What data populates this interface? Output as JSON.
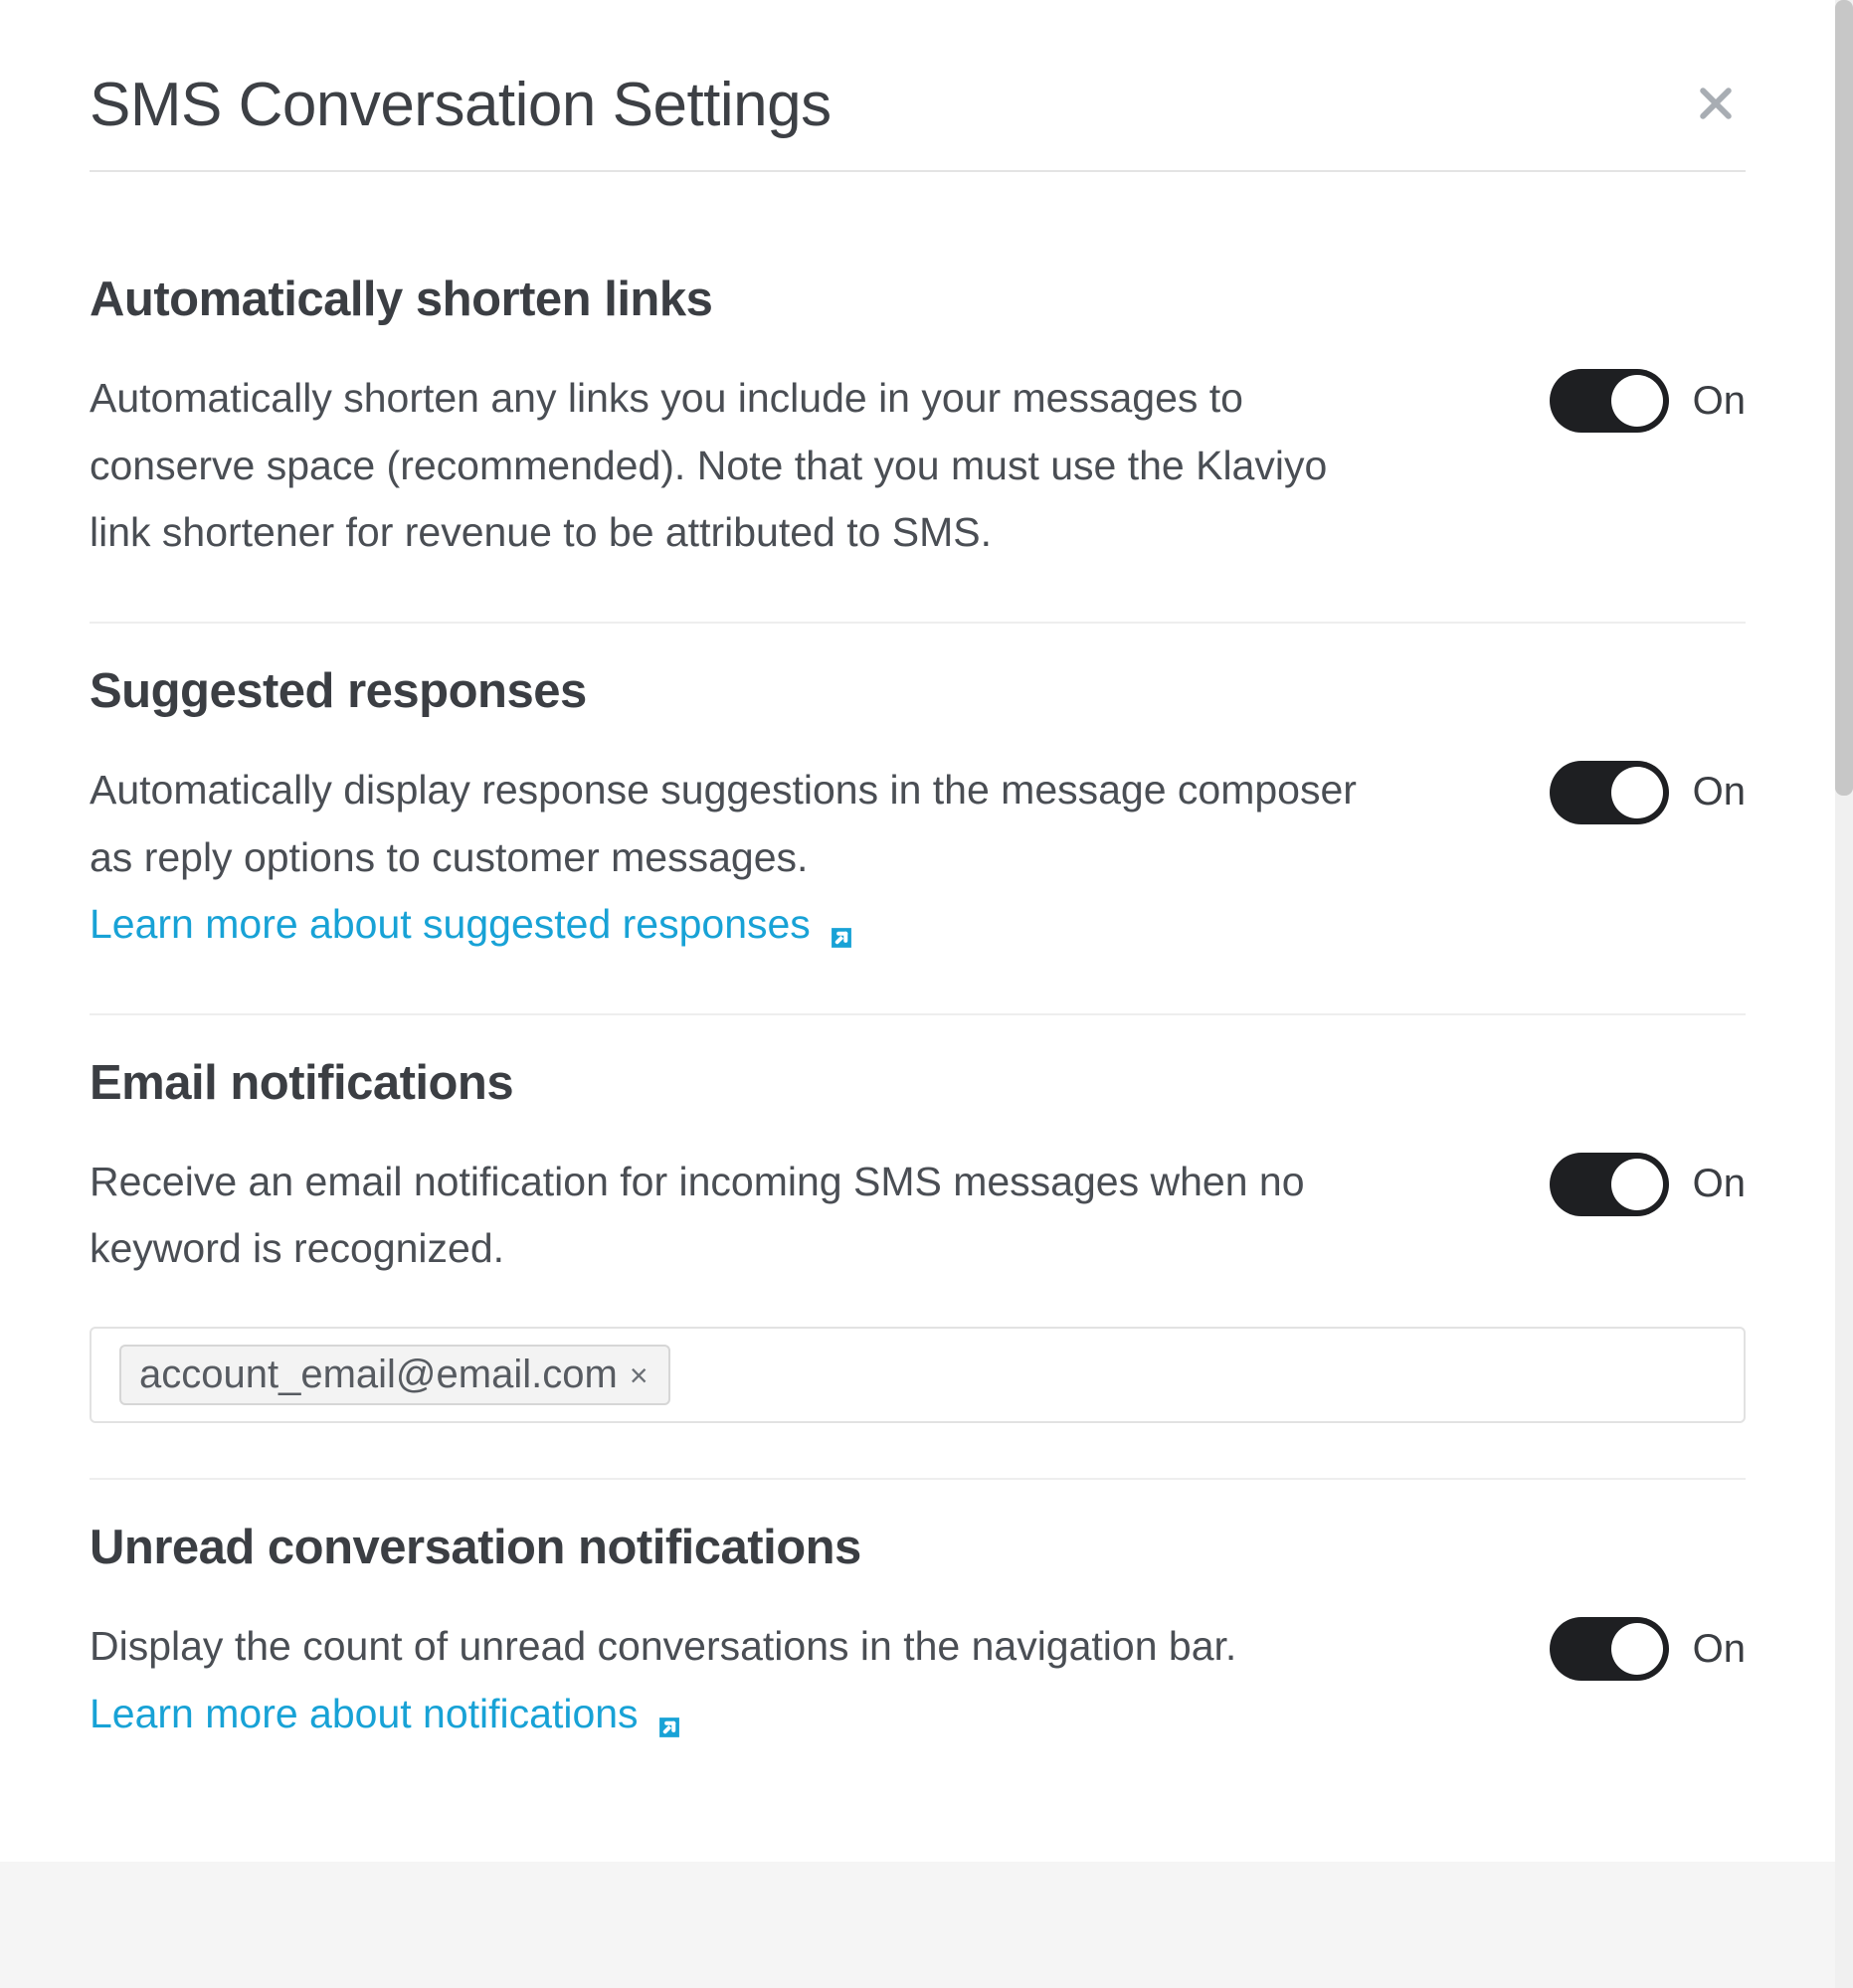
{
  "modal": {
    "title": "SMS Conversation Settings"
  },
  "sections": {
    "shorten": {
      "title": "Automatically shorten links",
      "description": "Automatically shorten any links you include in your messages to conserve space (recommended). Note that you must use the Klaviyo link shortener for revenue to be attributed to SMS.",
      "toggle_state": "On"
    },
    "suggested": {
      "title": "Suggested responses",
      "description": "Automatically display response suggestions in the message composer as reply options to customer messages.",
      "link_text": "Learn more about suggested responses",
      "toggle_state": "On"
    },
    "email_notif": {
      "title": "Email notifications",
      "description": "Receive an email notification for incoming SMS messages when no keyword is recognized.",
      "toggle_state": "On",
      "emails": [
        "account_email@email.com"
      ]
    },
    "unread": {
      "title": "Unread conversation notifications",
      "description": "Display the count of unread conversations in the navigation bar.",
      "link_text": "Learn more about notifications",
      "toggle_state": "On"
    }
  }
}
